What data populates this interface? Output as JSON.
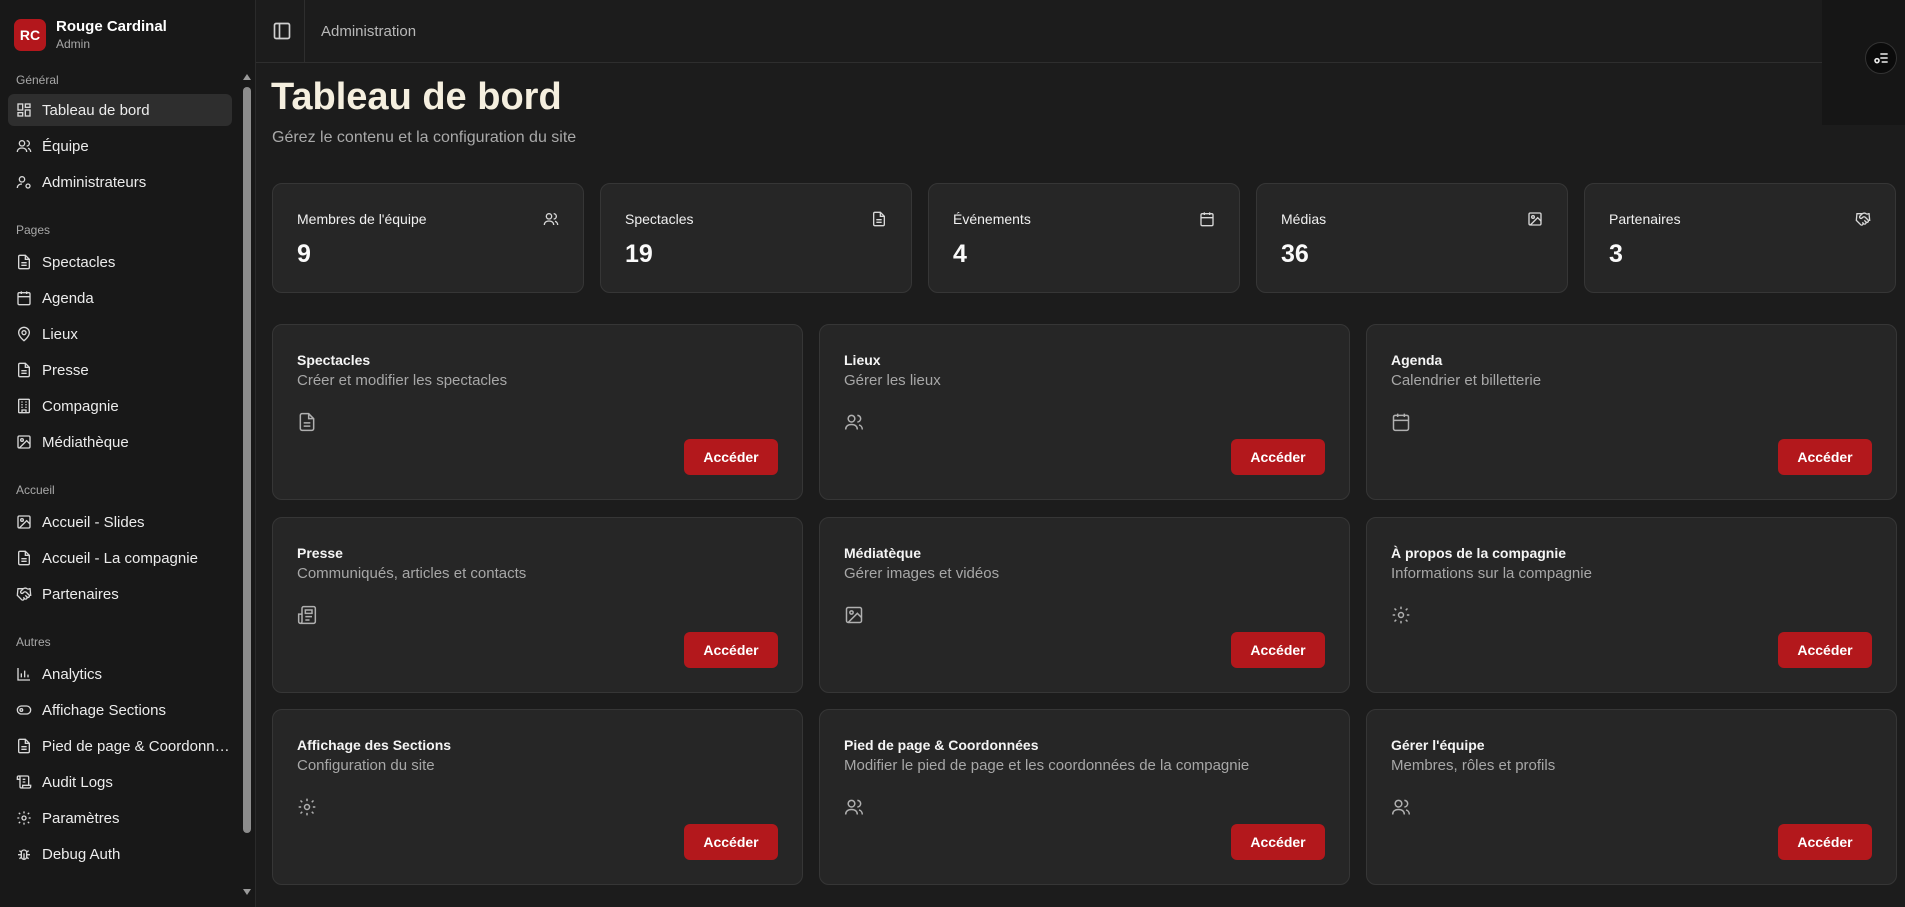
{
  "brand": {
    "initials": "RC",
    "name": "Rouge Cardinal",
    "role": "Admin",
    "accent": "#b3171c"
  },
  "sidebar": {
    "groups": [
      {
        "label": "Général",
        "items": [
          {
            "label": "Tableau de bord",
            "icon": "dashboard-icon",
            "active": true
          },
          {
            "label": "Équipe",
            "icon": "users-icon"
          },
          {
            "label": "Administrateurs",
            "icon": "user-cog-icon"
          }
        ]
      },
      {
        "label": "Pages",
        "items": [
          {
            "label": "Spectacles",
            "icon": "file-text-icon"
          },
          {
            "label": "Agenda",
            "icon": "calendar-icon"
          },
          {
            "label": "Lieux",
            "icon": "map-pin-icon"
          },
          {
            "label": "Presse",
            "icon": "file-text-icon"
          },
          {
            "label": "Compagnie",
            "icon": "building-icon"
          },
          {
            "label": "Médiathèque",
            "icon": "image-icon"
          }
        ]
      },
      {
        "label": "Accueil",
        "items": [
          {
            "label": "Accueil - Slides",
            "icon": "image-icon"
          },
          {
            "label": "Accueil - La compagnie",
            "icon": "file-text-icon"
          },
          {
            "label": "Partenaires",
            "icon": "handshake-icon"
          }
        ]
      },
      {
        "label": "Autres",
        "items": [
          {
            "label": "Analytics",
            "icon": "bar-chart-icon"
          },
          {
            "label": "Affichage Sections",
            "icon": "toggle-icon"
          },
          {
            "label": "Pied de page & Coordonn…",
            "icon": "file-text-icon"
          },
          {
            "label": "Audit Logs",
            "icon": "scroll-icon"
          },
          {
            "label": "Paramètres",
            "icon": "gear-icon"
          },
          {
            "label": "Debug Auth",
            "icon": "bug-icon"
          }
        ]
      }
    ]
  },
  "header": {
    "breadcrumb": "Administration"
  },
  "main": {
    "title": "Tableau de bord",
    "subtitle": "Gérez le contenu et la configuration du site",
    "stats": [
      {
        "label": "Membres de l'équipe",
        "value": "9",
        "icon": "users-icon"
      },
      {
        "label": "Spectacles",
        "value": "19",
        "icon": "file-text-icon"
      },
      {
        "label": "Événements",
        "value": "4",
        "icon": "calendar-icon"
      },
      {
        "label": "Médias",
        "value": "36",
        "icon": "image-icon"
      },
      {
        "label": "Partenaires",
        "value": "3",
        "icon": "handshake-icon"
      }
    ],
    "actions": [
      {
        "title": "Spectacles",
        "desc": "Créer et modifier les spectacles",
        "icon": "file-text-icon",
        "button": "Accéder"
      },
      {
        "title": "Lieux",
        "desc": "Gérer les lieux",
        "icon": "users-icon",
        "button": "Accéder"
      },
      {
        "title": "Agenda",
        "desc": "Calendrier et billetterie",
        "icon": "calendar-icon",
        "button": "Accéder"
      },
      {
        "title": "Presse",
        "desc": "Communiqués, articles et contacts",
        "icon": "newspaper-icon",
        "button": "Accéder"
      },
      {
        "title": "Médiatèque",
        "desc": "Gérer images et vidéos",
        "icon": "image-icon",
        "button": "Accéder"
      },
      {
        "title": "À propos de la compagnie",
        "desc": "Informations sur la compagnie",
        "icon": "gear-icon",
        "button": "Accéder"
      },
      {
        "title": "Affichage des Sections",
        "desc": "Configuration du site",
        "icon": "gear-icon",
        "button": "Accéder"
      },
      {
        "title": "Pied de page & Coordonnées",
        "desc": "Modifier le pied de page et les coordonnées de la compagnie",
        "icon": "users-icon",
        "button": "Accéder"
      },
      {
        "title": "Gérer l'équipe",
        "desc": "Membres, rôles et profils",
        "icon": "users-icon",
        "button": "Accéder"
      }
    ]
  }
}
